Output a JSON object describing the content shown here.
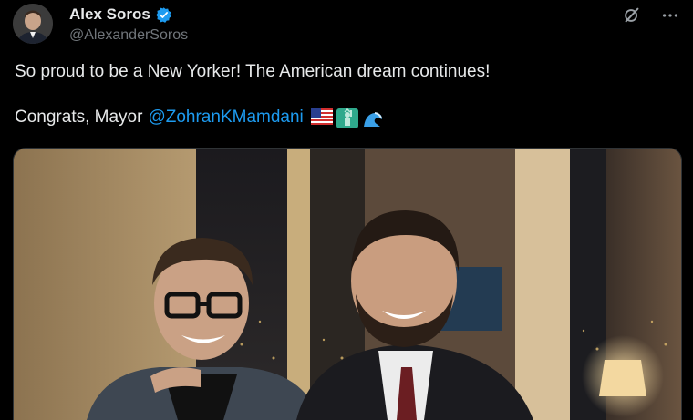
{
  "post": {
    "author_name": "Alex Soros",
    "author_handle": "@AlexanderSoros",
    "verified": true,
    "text_line_1": "So proud to be a New Yorker! The American dream continues!",
    "text_line_2_prefix": "Congrats, Mayor",
    "mention": "@ZohranKMamdani",
    "emojis": [
      "us-flag-emoji",
      "statue-of-liberty-emoji",
      "wave-emoji"
    ]
  },
  "actions": {
    "icons": [
      "grok-icon",
      "more-options-icon"
    ]
  },
  "colors": {
    "background": "#000000",
    "text": "#e7e9ea",
    "secondary_text": "#71767b",
    "accent": "#1d9bf0"
  }
}
